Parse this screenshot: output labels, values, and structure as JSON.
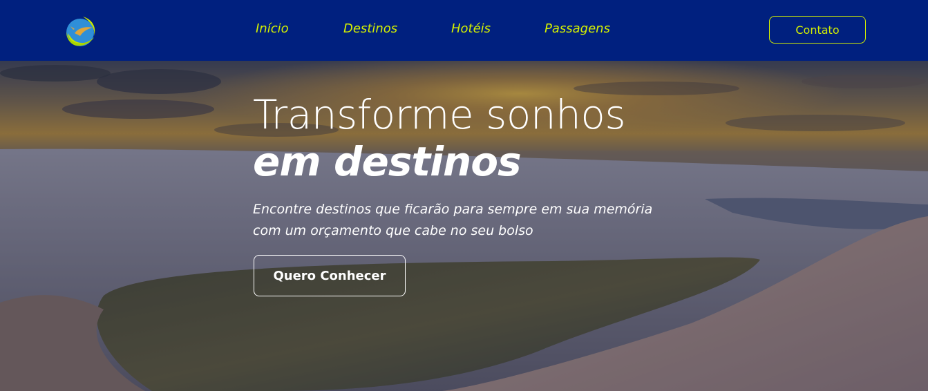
{
  "header": {
    "logo_icon": "globe-plane-logo-icon",
    "nav": [
      {
        "label": "Início"
      },
      {
        "label": "Destinos"
      },
      {
        "label": "Hotéis"
      },
      {
        "label": "Passagens"
      }
    ],
    "contact_label": "Contato"
  },
  "hero": {
    "background_icon": "sand-dunes-sunset-image",
    "title_line1": "Transforme sonhos",
    "title_line2": "em destinos",
    "subtitle_line1": "Encontre destinos que ficarão para sempre em sua memória",
    "subtitle_line2": "com um orçamento que cabe no seu bolso",
    "cta_label": "Quero Conhecer"
  },
  "colors": {
    "header_bg": "#00207f",
    "accent": "#d4f000",
    "text_light": "#ffffff"
  }
}
